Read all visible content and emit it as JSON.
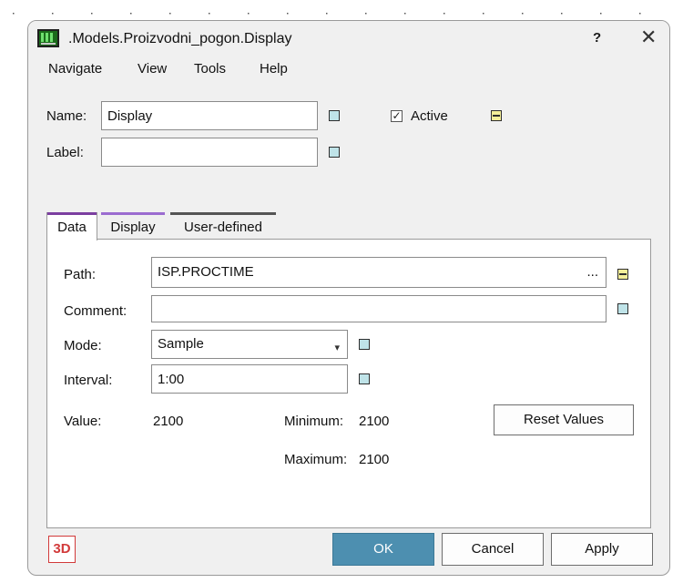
{
  "window": {
    "title": ".Models.Proizvodni_pogon.Display",
    "help_label": "?",
    "close_label": "✕"
  },
  "menu": [
    "Navigate",
    "View",
    "Tools",
    "Help"
  ],
  "form": {
    "name_label": "Name:",
    "name_value": "Display",
    "label_label": "Label:",
    "label_value": "",
    "active_label": "Active",
    "active_checked": true,
    "checkmark": "✓"
  },
  "tabs": [
    {
      "label": "Data",
      "color": "#7b3fa0",
      "active": true
    },
    {
      "label": "Display",
      "color": "#9b6cd0",
      "active": false
    },
    {
      "label": "User-defined",
      "color": "#555555",
      "active": false
    }
  ],
  "data_tab": {
    "path_label": "Path:",
    "path_value": "ISP.PROCTIME",
    "path_browse": "...",
    "comment_label": "Comment:",
    "comment_value": "",
    "mode_label": "Mode:",
    "mode_value": "Sample",
    "interval_label": "Interval:",
    "interval_value": "1:00",
    "value_label": "Value:",
    "value_value": "2100",
    "minimum_label": "Minimum:",
    "minimum_value": "2100",
    "maximum_label": "Maximum:",
    "maximum_value": "2100",
    "reset_label": "Reset Values"
  },
  "footer": {
    "badge_3d": "3D",
    "ok_label": "OK",
    "cancel_label": "Cancel",
    "apply_label": "Apply"
  },
  "colors": {
    "accent": "#4d8fb0",
    "indicator_teal": "#bfe3e8",
    "indicator_yellow": "#f3ee99"
  }
}
